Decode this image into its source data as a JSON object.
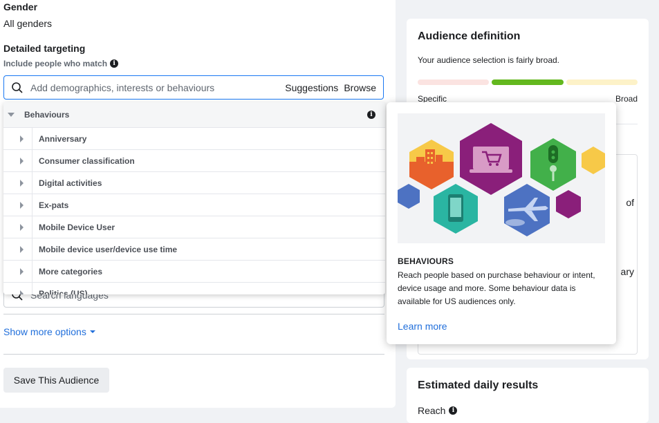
{
  "left": {
    "gender_label": "Gender",
    "gender_value": "All genders",
    "detailed_label": "Detailed targeting",
    "include_label": "Include people who match",
    "search_placeholder": "Add demographics, interests or behaviours",
    "suggestions": "Suggestions",
    "browse": "Browse",
    "dropdown": {
      "header": "Behaviours",
      "items": [
        {
          "label": "Anniversary"
        },
        {
          "label": "Consumer classification"
        },
        {
          "label": "Digital activities"
        },
        {
          "label": "Ex-pats"
        },
        {
          "label": "Mobile Device User"
        },
        {
          "label": "Mobile device user/device use time"
        },
        {
          "label": "More categories"
        },
        {
          "label": "Politics (US)"
        }
      ]
    },
    "languages_placeholder": "Search languages",
    "show_more": "Show more options",
    "save_button": "Save This Audience"
  },
  "audience_card": {
    "title": "Audience definition",
    "subtitle": "Your audience selection is fairly broad.",
    "specific": "Specific",
    "broad": "Broad",
    "partial_1": "of",
    "partial_2": "ary"
  },
  "popover": {
    "title": "BEHAVIOURS",
    "description": "Reach people based on purchase behaviour or intent, device usage and more. Some behaviour data is available for US audiences only.",
    "learn_more": "Learn more"
  },
  "estimated_card": {
    "title": "Estimated daily results",
    "reach_label": "Reach"
  },
  "colors": {
    "accent": "#1877f2",
    "link": "#216fdb",
    "meter_low": "#fbe3e1",
    "meter_mid": "#63b81e",
    "meter_high": "#fdf2c8"
  }
}
